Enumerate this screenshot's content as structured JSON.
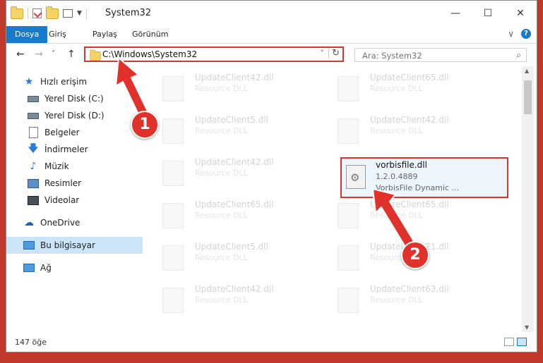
{
  "window": {
    "title": "System32",
    "minimize": "—",
    "maximize": "☐",
    "close": "✕"
  },
  "ribbon": {
    "tabs": [
      "Dosya",
      "Giriş",
      "Paylaş",
      "Görünüm"
    ],
    "expand": "∨",
    "help": "?"
  },
  "nav": {
    "back": "←",
    "forward": "→",
    "recent": "˅",
    "up": "↑",
    "address": "C:\\Windows\\System32",
    "address_dropdown": "˅",
    "refresh": "↻",
    "search_placeholder": "Ara: System32",
    "search_icon": "⌕"
  },
  "sidebar": {
    "items": [
      {
        "label": "Hızlı erişim",
        "icon": "star-icon"
      },
      {
        "label": "Yerel Disk (C:)",
        "icon": "drive-icon"
      },
      {
        "label": "Yerel Disk (D:)",
        "icon": "drive-icon"
      },
      {
        "label": "Belgeler",
        "icon": "documents-icon"
      },
      {
        "label": "İndirmeler",
        "icon": "download-icon"
      },
      {
        "label": "Müzik",
        "icon": "music-icon"
      },
      {
        "label": "Resimler",
        "icon": "pictures-icon"
      },
      {
        "label": "Videolar",
        "icon": "videos-icon"
      },
      {
        "label": "OneDrive",
        "icon": "cloud-icon"
      },
      {
        "label": "Bu bilgisayar",
        "icon": "computer-icon"
      },
      {
        "label": "Ağ",
        "icon": "network-icon"
      }
    ]
  },
  "files": [
    {
      "name": "UpdateClient42.dll",
      "type": "Resource DLL"
    },
    {
      "name": "UpdateClient65.dll",
      "type": "Resource DLL"
    },
    {
      "name": "UpdateClient5.dll",
      "type": "Resource DLL"
    },
    {
      "name": "UpdateClient42.dll",
      "type": "Resource DLL"
    },
    {
      "name": "UpdateClient42.dll",
      "type": "Resource DLL"
    },
    {
      "name": "UpdateClient65.dll",
      "type": "Resource DLL"
    },
    {
      "name": "UpdateClient65.dll",
      "type": "Resource DLL"
    },
    {
      "name": "UpdateClient5.dll",
      "type": "Resource DLL"
    },
    {
      "name": "UpdateClient21.dll",
      "type": "Resource DLL"
    },
    {
      "name": "UpdateClient42.dll",
      "type": "Resource DLL"
    },
    {
      "name": "UpdateClient63.dll",
      "type": "Resource DLL"
    }
  ],
  "highlighted_file": {
    "name": "vorbisfile.dll",
    "version": "1.2.0.4889",
    "description": "VorbisFile Dynamic ..."
  },
  "status": {
    "count": "147 öğe"
  },
  "markers": {
    "one": "1",
    "two": "2"
  },
  "colors": {
    "accent": "#1979ca",
    "highlight": "#e0322b"
  }
}
